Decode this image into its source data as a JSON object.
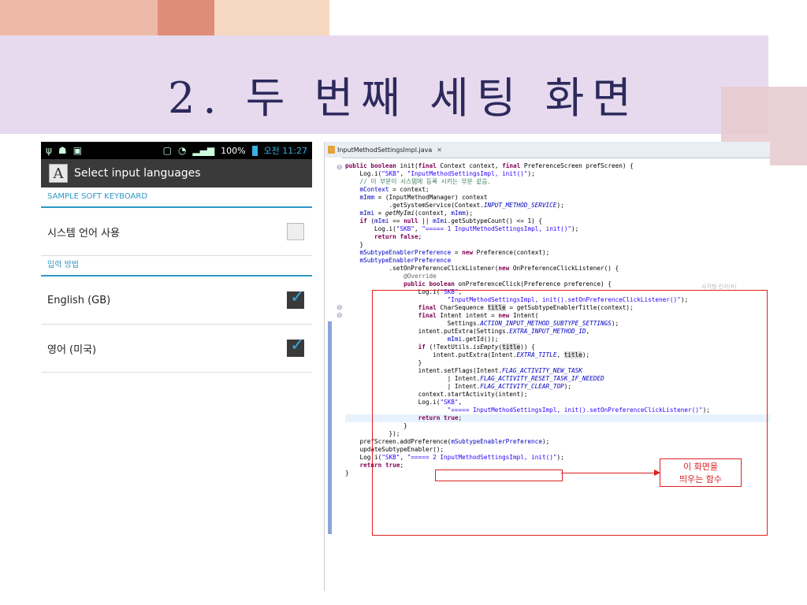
{
  "slide": {
    "title": "2. 두 번째 세팅 화면"
  },
  "phone": {
    "status": {
      "battery": "100%",
      "time": "오전 11:27"
    },
    "actionbar": {
      "icon_letter": "A",
      "title": "Select input languages"
    },
    "sections": [
      {
        "header": "SAMPLE SOFT KEYBOARD",
        "items": [
          {
            "label": "시스템 언어 사용",
            "checked": false
          }
        ]
      },
      {
        "header": "입력 방법",
        "items": [
          {
            "label": "English (GB)",
            "checked": true
          },
          {
            "label": "영어 (미국)",
            "checked": true
          }
        ]
      }
    ]
  },
  "editor": {
    "tab_label": "InputMethodSettingsImpl.java",
    "tab_close": "✕",
    "ghost_label": "사각형 린저(R)",
    "code_lines": [
      "public boolean init(final Context context, final PreferenceScreen prefScreen) {",
      "    Log.i(\"SKB\", \"InputMethodSettingsImpl, init()\");",
      "    // 이 부분이 시스템에 등록 시키는 부분 같음.",
      "    mContext = context;",
      "    mImm = (InputMethodManager) context",
      "            .getSystemService(Context.INPUT_METHOD_SERVICE);",
      "    mImi = getMyImi(context, mImm);",
      "    if (mImi == null || mImi.getSubtypeCount() <= 1) {",
      "        Log.i(\"SKB\", \"===== 1 InputMethodSettingsImpl, init()\");",
      "        return false;",
      "    }",
      "    mSubtypeEnablerPreference = new Preference(context);",
      "    mSubtypeEnablerPreference",
      "            .setOnPreferenceClickListener(new OnPreferenceClickListener() {",
      "                @Override",
      "                public boolean onPreferenceClick(Preference preference) {",
      "                    Log.i(\"SKB\",",
      "                            \"InputMethodSettingsImpl, init().setOnPreferenceClickListener()\");",
      "                    final CharSequence title = getSubtypeEnablerTitle(context);",
      "                    final Intent intent = new Intent(",
      "                            Settings.ACTION_INPUT_METHOD_SUBTYPE_SETTINGS);",
      "                    intent.putExtra(Settings.EXTRA_INPUT_METHOD_ID,",
      "                            mImi.getId());",
      "                    if (!TextUtils.isEmpty(title)) {",
      "                        intent.putExtra(Intent.EXTRA_TITLE, title);",
      "                    }",
      "                    intent.setFlags(Intent.FLAG_ACTIVITY_NEW_TASK",
      "                            | Intent.FLAG_ACTIVITY_RESET_TASK_IF_NEEDED",
      "                            | Intent.FLAG_ACTIVITY_CLEAR_TOP);",
      "                    context.startActivity(intent);",
      "                    Log.i(\"SKB\",",
      "                            \"===== InputMethodSettingsImpl, init().setOnPreferenceClickListener()\");",
      "                    return true;",
      "                }",
      "            });",
      "    prefScreen.addPreference(mSubtypeEnablerPreference);",
      "    updateSubtypeEnabler();",
      "    Log.i(\"SKB\", \"===== 2 InputMethodSettingsImpl, init()\");",
      "    return true;",
      "}"
    ],
    "callout": {
      "line1": "이 화면을",
      "line2": "띄우는 함수"
    }
  }
}
